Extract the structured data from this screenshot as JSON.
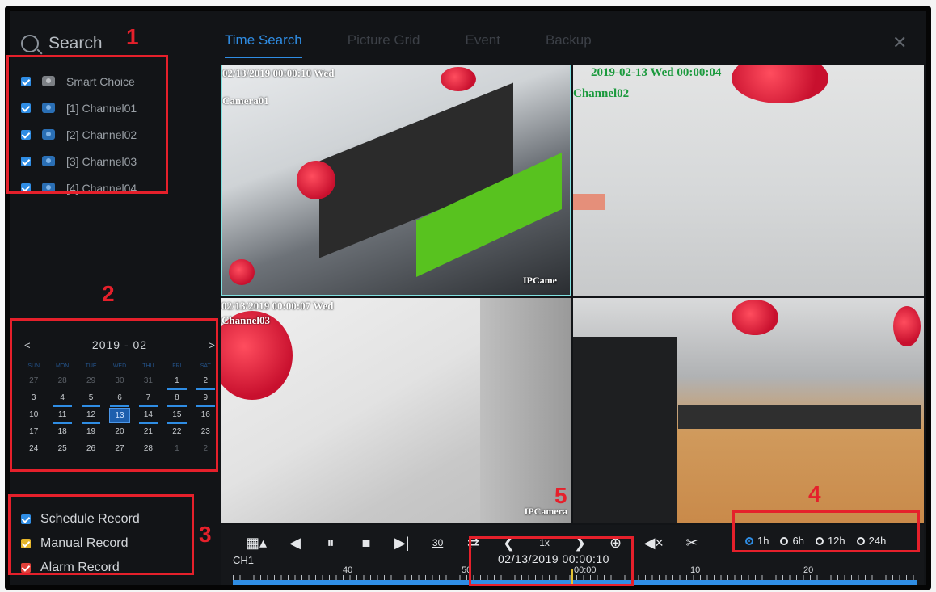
{
  "search": {
    "title": "Search"
  },
  "tabs": [
    "Time Search",
    "Picture Grid",
    "Event",
    "Backup"
  ],
  "close_icon": "close-icon",
  "channels": {
    "smart_choice": "Smart Choice",
    "items": [
      "[1] Channel01",
      "[2] Channel02",
      "[3] Channel03",
      "[4] Channel04"
    ]
  },
  "calendar": {
    "prev": "<",
    "next": ">",
    "year_month": "2019 - 02",
    "weekdays": [
      "SUN",
      "MON",
      "TUE",
      "WED",
      "THU",
      "FRI",
      "SAT"
    ],
    "days": [
      {
        "d": "27",
        "cls": "other"
      },
      {
        "d": "28",
        "cls": "other"
      },
      {
        "d": "29",
        "cls": "other"
      },
      {
        "d": "30",
        "cls": "other"
      },
      {
        "d": "31",
        "cls": "other"
      },
      {
        "d": "1",
        "cls": "rec"
      },
      {
        "d": "2",
        "cls": "rec"
      },
      {
        "d": "3",
        "cls": ""
      },
      {
        "d": "4",
        "cls": "rec"
      },
      {
        "d": "5",
        "cls": "rec"
      },
      {
        "d": "6",
        "cls": "rec"
      },
      {
        "d": "7",
        "cls": "rec"
      },
      {
        "d": "8",
        "cls": "rec"
      },
      {
        "d": "9",
        "cls": "rec"
      },
      {
        "d": "10",
        "cls": ""
      },
      {
        "d": "11",
        "cls": "rec"
      },
      {
        "d": "12",
        "cls": "rec"
      },
      {
        "d": "13",
        "cls": "sel"
      },
      {
        "d": "14",
        "cls": "rec"
      },
      {
        "d": "15",
        "cls": "rec"
      },
      {
        "d": "16",
        "cls": ""
      },
      {
        "d": "17",
        "cls": ""
      },
      {
        "d": "18",
        "cls": ""
      },
      {
        "d": "19",
        "cls": ""
      },
      {
        "d": "20",
        "cls": ""
      },
      {
        "d": "21",
        "cls": ""
      },
      {
        "d": "22",
        "cls": ""
      },
      {
        "d": "23",
        "cls": ""
      },
      {
        "d": "24",
        "cls": ""
      },
      {
        "d": "25",
        "cls": ""
      },
      {
        "d": "26",
        "cls": ""
      },
      {
        "d": "27",
        "cls": ""
      },
      {
        "d": "28",
        "cls": ""
      },
      {
        "d": "1",
        "cls": "other"
      },
      {
        "d": "2",
        "cls": "other"
      }
    ]
  },
  "legend": [
    {
      "label": "Schedule Record",
      "color": "#2f8de4"
    },
    {
      "label": "Manual Record",
      "color": "#e6b52a"
    },
    {
      "label": "Alarm Record",
      "color": "#e0403a"
    }
  ],
  "videos": [
    {
      "date": "02/13/2019 00:00:10 Wed",
      "channel": "Camera01",
      "ipc": "IPCame"
    },
    {
      "date": "2019-02-13 Wed 00:00:04",
      "channel": "Channel02",
      "ipc": ""
    },
    {
      "date": "02/13/2019 00:00:07 Wed",
      "channel": "Channel03",
      "ipc": "IPCamera"
    },
    {
      "date": "",
      "channel": "",
      "ipc": ""
    }
  ],
  "controls": {
    "speed": "1x",
    "skip": "30",
    "channel_label": "CH1",
    "timestamp": "02/13/2019 00:00:10",
    "ranges": [
      "1h",
      "6h",
      "12h",
      "24h"
    ],
    "selected_range": "1h",
    "timeline_labels": [
      "40",
      "50",
      "00:00",
      "10",
      "20"
    ]
  },
  "annotations": [
    "1",
    "2",
    "3",
    "4",
    "5"
  ]
}
